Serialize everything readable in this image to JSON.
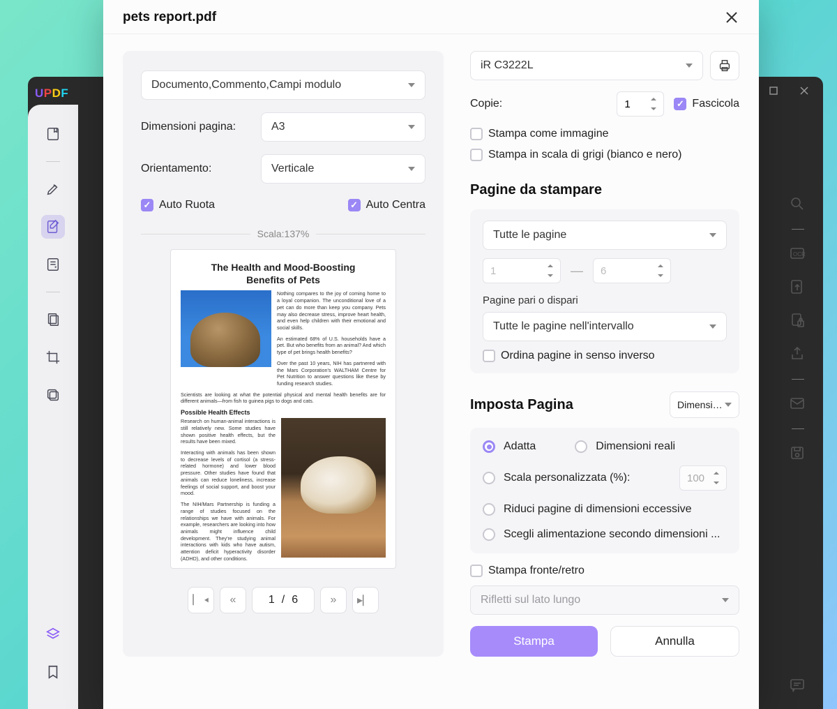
{
  "brand": "UPDF",
  "dialog": {
    "title": "pets report.pdf"
  },
  "left": {
    "contentSelect": "Documento,Commento,Campi modulo",
    "pageSize": {
      "label": "Dimensioni pagina:",
      "value": "A3"
    },
    "orientation": {
      "label": "Orientamento:",
      "value": "Verticale"
    },
    "autoRotate": "Auto Ruota",
    "autoCenter": "Auto Centra",
    "scaleText": "Scala:137%",
    "pager": {
      "current": "1",
      "sep": "/",
      "total": "6"
    }
  },
  "preview": {
    "title1": "The Health and Mood-Boosting",
    "title2": "Benefits of Pets",
    "p1": "Nothing compares to the joy of coming home to a loyal companion. The unconditional love of a pet can do more than keep you company. Pets may also decrease stress, improve heart health, and even help children with their emotional and social skills.",
    "p2": "An estimated 68% of U.S. households have a pet. But who benefits from an animal? And which type of pet brings health benefits?",
    "p3": "Over the past 10 years, NIH has partnered with the Mars Corporation's WALTHAM Centre for Pet Nutrition to answer questions like these by funding research studies.",
    "p4": "Scientists are looking at what the potential physical and mental health benefits are for different animals—from fish to guinea pigs to dogs and cats.",
    "sub": "Possible Health Effects",
    "p5": "Research on human-animal interactions is still relatively new. Some studies have shown positive health effects, but the results have been mixed.",
    "p6": "Interacting with animals has been shown to decrease levels of cortisol (a stress-related hormone) and lower blood pressure. Other studies have found that animals can reduce loneliness, increase feelings of social support, and boost your mood.",
    "p7": "The NIH/Mars Partnership is funding a range of studies focused on the relationships we have with animals. For example, researchers are looking into how animals might influence child development. They're studying animal interactions with kids who have autism, attention deficit hyperactivity disorder (ADHD), and other conditions."
  },
  "right": {
    "printer": "iR C3222L",
    "copies": {
      "label": "Copie:",
      "value": "1"
    },
    "collate": "Fascicola",
    "asImage": "Stampa come immagine",
    "grayscale": "Stampa in scala di grigi (bianco e nero)",
    "pagesTitle": "Pagine da stampare",
    "pagesSelect": "Tutte le pagine",
    "rangeFrom": "1",
    "rangeTo": "6",
    "oddEvenLabel": "Pagine pari o dispari",
    "oddEvenValue": "Tutte le pagine nell'intervallo",
    "reverse": "Ordina pagine in senso inverso",
    "scaleTitle": "Imposta Pagina",
    "dimSelect": "Dimensioni",
    "fit": "Adatta",
    "actual": "Dimensioni reali",
    "customScale": "Scala personalizzata (%):",
    "customScaleValue": "100",
    "shrink": "Riduci pagine di dimensioni eccessive",
    "choosePaper": "Scegli alimentazione secondo dimensioni ...",
    "duplex": "Stampa fronte/retro",
    "flip": "Rifletti sul lato lungo",
    "print": "Stampa",
    "cancel": "Annulla"
  }
}
